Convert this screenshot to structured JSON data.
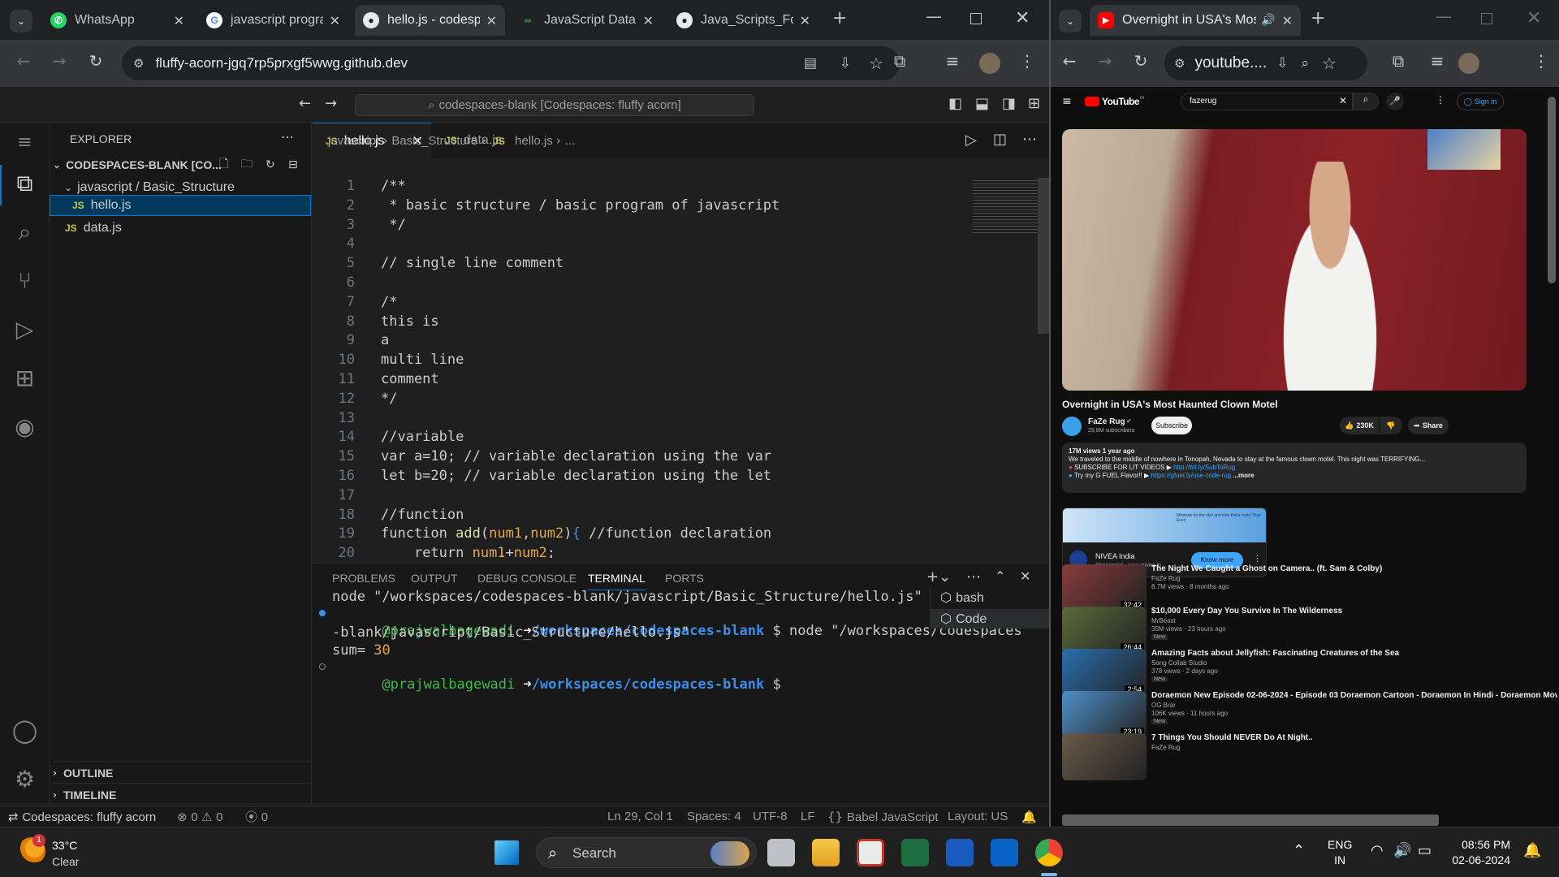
{
  "left_window": {
    "tabs": [
      {
        "title": "WhatsApp",
        "color": "#25d366"
      },
      {
        "title": "javascript progra",
        "color": "#4285f4"
      },
      {
        "title": "hello.js - codesp",
        "color": "#e8eaed"
      },
      {
        "title": "JavaScript Data",
        "color": "#3d9b4a"
      },
      {
        "title": "Java_Scripts_For",
        "color": "#e8eaed"
      }
    ],
    "url": "fluffy-acorn-jgq7rp5prxgf5wwg.github.dev"
  },
  "right_window": {
    "tab_title": "Overnight in USA's Most Ha",
    "url": "youtube...."
  },
  "vscode": {
    "command_center": "codespaces-blank [Codespaces: fluffy acorn]",
    "explorer_title": "EXPLORER",
    "workspace": "CODESPACES-BLANK [CO...",
    "folder": "javascript / Basic_Structure",
    "files": [
      "hello.js",
      "data.js"
    ],
    "outline": "OUTLINE",
    "timeline": "TIMELINE",
    "editor_tabs": [
      "hello.js",
      "data.js"
    ],
    "breadcrumb": [
      "javascript",
      "Basic_Structure",
      "hello.js",
      "..."
    ],
    "code_lines": [
      "/**",
      " * basic structure / basic program of javascript",
      " */",
      "",
      "// single line comment",
      "",
      "/*",
      "this is",
      "a",
      "multi line",
      "comment",
      "*/",
      "",
      "//variable",
      "var a=10; // variable declaration using the var",
      "let b=20; // variable declaration using the let",
      "",
      "//function",
      "function add(num1,num2){ //function declaration",
      "    return num1+num2;"
    ],
    "panel_tabs": [
      "PROBLEMS",
      "OUTPUT",
      "DEBUG CONSOLE",
      "TERMINAL",
      "PORTS"
    ],
    "terminal": {
      "line1": "node \"/workspaces/codespaces-blank/javascript/Basic_Structure/hello.js\"",
      "user": "@prajwalbagewadi",
      "arrow": "➜",
      "path": "/workspaces/codespaces-blank",
      "cmd": "$ node \"/workspaces/codespaces",
      "cont": "-blank/javascript/Basic_Structure/hello.js\"",
      "out_label": "sum=",
      "out_value": "30",
      "prompt_end": "$"
    },
    "terminal_list": [
      "bash",
      "Code"
    ],
    "status": {
      "remote": "Codespaces: fluffy acorn",
      "errors": "0",
      "warnings": "0",
      "ports": "0",
      "position": "Ln 29, Col 1",
      "spaces": "Spaces: 4",
      "encoding": "UTF-8",
      "eol": "LF",
      "language": "Babel JavaScript",
      "layout": "Layout: US"
    }
  },
  "youtube": {
    "logo": "YouTube",
    "country": "IN",
    "search_value": "fazerug",
    "sign_in": "Sign in",
    "video_title": "Overnight in USA's Most Haunted Clown Motel",
    "channel": "FaZe Rug",
    "subscribers": "25.8M subscribers",
    "subscribe": "Subscribe",
    "likes": "230K",
    "share": "Share",
    "views_date": "17M views  1 year ago",
    "desc1": "We traveled to the middle of nowhere in Tonopah, Nevada to stay at the famous clown motel. This night was TERRIFYING...",
    "desc2": "SUBSCRIBE FOR LIT VIDEOS ▶",
    "desc2_link": "http://bit.ly/SubToRug",
    "desc3": "Try my G FUEL Flavor!! ▶",
    "desc3_link": "https://gfuel.ly/use-code-rug",
    "more": "...more",
    "ad_brand": "NIVEA India",
    "ad_sponsored": "Sponsored · www.nivea.in",
    "ad_button": "Know more",
    "ad_banner": "Moisture for the skin and love that's more Than Ever!",
    "recommendations": [
      {
        "title": "The Night We Caught a Ghost on Camera.. (ft. Sam & Colby)",
        "channel": "FaZe Rug",
        "meta": "8.7M views · 8 months ago",
        "dur": "32:42",
        "badge": "",
        "color": "#8a3b3b"
      },
      {
        "title": "$10,000 Every Day You Survive In The Wilderness",
        "channel": "MrBeast",
        "meta": "35M views · 23 hours ago",
        "dur": "26:44",
        "badge": "New",
        "color": "#5a6b3a"
      },
      {
        "title": "Amazing Facts about Jellyfish: Fascinating Creatures of the Sea",
        "channel": "Song Collab Studio",
        "meta": "378 views · 2 days ago",
        "dur": "2:54",
        "badge": "New",
        "color": "#2a6fb0"
      },
      {
        "title": "Doraemon New Episode 02-06-2024 - Episode 03 Doraemon Cartoon - Doraemon In Hindi - Doraemon Movie",
        "channel": "OG Brar",
        "meta": "106K views · 11 hours ago",
        "dur": "23:19",
        "badge": "New",
        "color": "#4f8fc9"
      },
      {
        "title": "7 Things You Should NEVER Do At Night..",
        "channel": "FaZe Rug",
        "meta": "",
        "dur": "",
        "badge": "",
        "color": "#6b5a4a"
      }
    ]
  },
  "taskbar": {
    "temp": "33°C",
    "weather": "Clear",
    "search": "Search",
    "lang1": "ENG",
    "lang2": "IN",
    "time": "08:56 PM",
    "date": "02-06-2024",
    "notif_badge": "1"
  }
}
